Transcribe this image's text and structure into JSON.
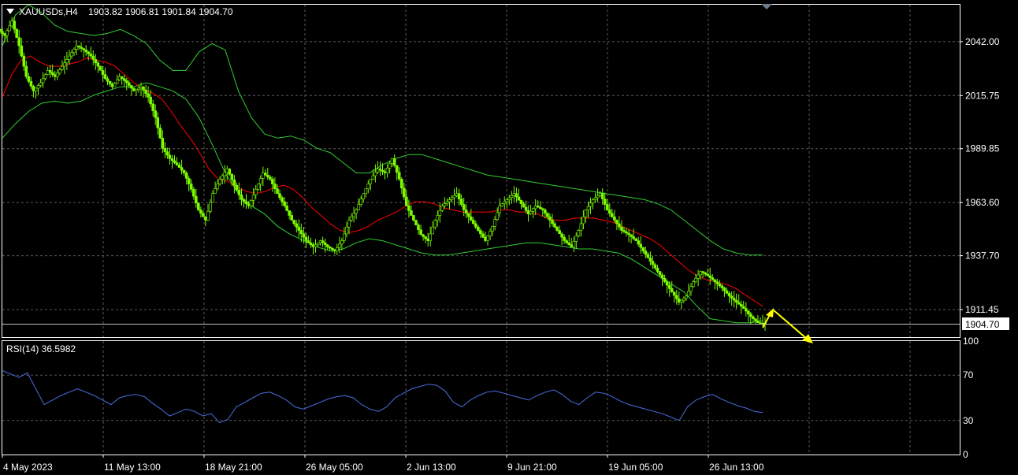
{
  "chart_data": [
    {
      "type": "candlestick",
      "symbol_label": "XAUUSDs,H4",
      "ohlc_label": "1903.82 1906.81 1901.84 1904.70",
      "current_price": 1904.7,
      "current_price_label": "1904.70",
      "ylim": [
        1898,
        2060
      ],
      "yticks": [
        "2042.00",
        "2015.75",
        "1989.85",
        "1963.60",
        "1937.70",
        "1911.45"
      ],
      "ytick_values": [
        2042.0,
        2015.75,
        1989.85,
        1963.6,
        1937.7,
        1911.45
      ],
      "xticks": [
        "4 May 2023",
        "11 May 13:00",
        "18 May 21:00",
        "26 May 05:00",
        "2 Jun 13:00",
        "9 Jun 21:00",
        "19 Jun 05:00",
        "26 Jun 13:00"
      ],
      "grid": true,
      "colors": {
        "candles": "#7CFC00",
        "middle_band": "#ff0000",
        "outer_bands": "#32cd32",
        "annotation": "#ffff00",
        "grid": "#5a5a5a"
      },
      "close_series": [
        2045,
        2052,
        2040,
        2025,
        2018,
        2022,
        2028,
        2025,
        2030,
        2035,
        2040,
        2038,
        2035,
        2030,
        2024,
        2020,
        2025,
        2022,
        2018,
        2020,
        2015,
        2005,
        1990,
        1985,
        1982,
        1978,
        1970,
        1960,
        1955,
        1968,
        1975,
        1980,
        1972,
        1965,
        1962,
        1970,
        1978,
        1975,
        1968,
        1962,
        1955,
        1950,
        1945,
        1942,
        1945,
        1942,
        1940,
        1945,
        1955,
        1960,
        1968,
        1975,
        1980,
        1978,
        1985,
        1975,
        1962,
        1955,
        1948,
        1945,
        1955,
        1962,
        1965,
        1968,
        1960,
        1955,
        1950,
        1945,
        1952,
        1962,
        1965,
        1968,
        1963,
        1958,
        1962,
        1960,
        1955,
        1950,
        1945,
        1942,
        1950,
        1960,
        1965,
        1968,
        1960,
        1955,
        1950,
        1948,
        1945,
        1940,
        1935,
        1930,
        1925,
        1920,
        1915,
        1918,
        1925,
        1930,
        1928,
        1925,
        1922,
        1918,
        1915,
        1912,
        1908,
        1905,
        1904.7
      ],
      "middle_band": [
        2015,
        2026,
        2033,
        2035,
        2032,
        2030,
        2030,
        2031,
        2032,
        2034,
        2033,
        2032,
        2030,
        2026,
        2022,
        2019,
        2017,
        2014,
        2008,
        2001,
        1995,
        1988,
        1980,
        1975,
        1974,
        1971,
        1969,
        1968,
        1969,
        1971,
        1972,
        1970,
        1966,
        1961,
        1957,
        1953,
        1950,
        1949,
        1950,
        1952,
        1955,
        1957,
        1959,
        1962,
        1964,
        1964,
        1963,
        1961,
        1960,
        1959,
        1959,
        1959,
        1959,
        1960,
        1960,
        1959,
        1959,
        1958,
        1956,
        1955,
        1955,
        1956,
        1956,
        1956,
        1955,
        1954,
        1952,
        1950,
        1948,
        1946,
        1943,
        1939,
        1935,
        1931,
        1928,
        1926,
        1925,
        1924,
        1922,
        1919,
        1916,
        1913
      ],
      "upper_band": [
        2040,
        2055,
        2060,
        2056,
        2050,
        2047,
        2046,
        2045,
        2046,
        2048,
        2045,
        2041,
        2033,
        2028,
        2028,
        2037,
        2041,
        2038,
        2018,
        2005,
        1997,
        1995,
        1996,
        1994,
        1990,
        1988,
        1983,
        1978,
        1978,
        1982,
        1985,
        1987,
        1987,
        1985,
        1983,
        1981,
        1979,
        1977,
        1976,
        1975,
        1974,
        1973,
        1972,
        1971,
        1970,
        1969,
        1968,
        1967,
        1966,
        1965,
        1963,
        1960,
        1955,
        1950,
        1945,
        1941,
        1939,
        1938,
        1938
      ],
      "lower_band": [
        1995,
        2002,
        2008,
        2012,
        2013,
        2012,
        2013,
        2016,
        2018,
        2020,
        2020,
        2022,
        2020,
        2018,
        2014,
        2005,
        1992,
        1978,
        1968,
        1962,
        1958,
        1952,
        1948,
        1945,
        1942,
        1940,
        1941,
        1944,
        1946,
        1945,
        1943,
        1941,
        1939,
        1938,
        1938,
        1939,
        1940,
        1941,
        1942,
        1943,
        1944,
        1944,
        1943,
        1942,
        1941,
        1941,
        1940,
        1939,
        1936,
        1932,
        1928,
        1924,
        1920,
        1913,
        1907,
        1906,
        1905,
        1905,
        1906
      ]
    },
    {
      "type": "line",
      "indicator_label": "RSI(14) 36.5982",
      "ylim": [
        0,
        100
      ],
      "yticks": [
        "100",
        "70",
        "30",
        "0"
      ],
      "ytick_values": [
        100,
        70,
        30,
        0
      ],
      "colors": {
        "line": "#4a6ee0"
      },
      "values": [
        74,
        71,
        68,
        72,
        58,
        44,
        48,
        52,
        55,
        58,
        55,
        52,
        48,
        44,
        50,
        52,
        53,
        51,
        45,
        40,
        34,
        37,
        40,
        38,
        34,
        36,
        28,
        31,
        42,
        46,
        50,
        54,
        55,
        52,
        48,
        42,
        40,
        43,
        46,
        49,
        51,
        52,
        50,
        44,
        40,
        38,
        42,
        50,
        54,
        58,
        60,
        62,
        61,
        56,
        46,
        42,
        48,
        52,
        55,
        56,
        54,
        52,
        50,
        48,
        52,
        55,
        57,
        53,
        47,
        44,
        50,
        55,
        54,
        51,
        47,
        44,
        42,
        40,
        38,
        36,
        33,
        30,
        42,
        48,
        51,
        53,
        49,
        46,
        43,
        41,
        38,
        37
      ]
    }
  ]
}
